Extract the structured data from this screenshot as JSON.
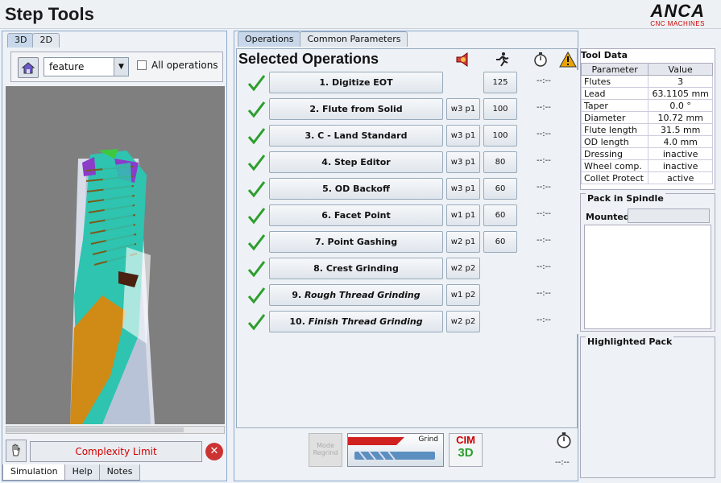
{
  "app": {
    "title": "Step Tools",
    "logo_text": "ANCA",
    "logo_sub": "CNC MACHINES"
  },
  "left": {
    "tabs": [
      "3D",
      "2D"
    ],
    "feature_select": "feature",
    "all_operations_label": "All operations",
    "complexity_label": "Complexity Limit",
    "bottom_tabs": [
      "Simulation",
      "Help",
      "Notes"
    ]
  },
  "center": {
    "tabs": [
      "Operations",
      "Common Parameters"
    ],
    "section_title": "Selected Operations",
    "operations": [
      {
        "label": "1. Digitize EOT",
        "wp": "",
        "num": "125",
        "time": "--:--"
      },
      {
        "label": "2. Flute from Solid",
        "wp": "w3 p1",
        "num": "100",
        "time": "--:--"
      },
      {
        "label": "3. C - Land Standard",
        "wp": "w3 p1",
        "num": "100",
        "time": "--:--"
      },
      {
        "label": "4. Step Editor",
        "wp": "w3 p1",
        "num": "80",
        "time": "--:--"
      },
      {
        "label": "5. OD Backoff",
        "wp": "w3 p1",
        "num": "60",
        "time": "--:--"
      },
      {
        "label": "6. Facet Point",
        "wp": "w1 p1",
        "num": "60",
        "time": "--:--"
      },
      {
        "label": "7. Point Gashing",
        "wp": "w2 p1",
        "num": "60",
        "time": "--:--"
      },
      {
        "label": "8. Crest Grinding",
        "wp": "w2 p2",
        "num": "",
        "time": "--:--"
      },
      {
        "label": "9. Rough Thread Grinding",
        "wp": "w1 p2",
        "num": "",
        "time": "--:--"
      },
      {
        "label": "10. Finish Thread Grinding",
        "wp": "w2 p2",
        "num": "",
        "time": "--:--"
      }
    ],
    "op9_num": "9.",
    "op9_text": "Rough Thread Grinding",
    "op10_num": "10.",
    "op10_text": "Finish Thread Grinding",
    "mode_btn": "Mode Regrind",
    "grind_label": "Grind",
    "cim_label": "CIM",
    "cim_sub": "3D",
    "total_time": "--:--"
  },
  "tool_data": {
    "title": "Tool Data",
    "col_param": "Parameter",
    "col_value": "Value",
    "rows": [
      {
        "p": "Flutes",
        "v": "3"
      },
      {
        "p": "Lead",
        "v": "63.1105 mm"
      },
      {
        "p": "Taper",
        "v": "0.0 °"
      },
      {
        "p": "Diameter",
        "v": "10.72 mm"
      },
      {
        "p": "Flute length",
        "v": "31.5 mm"
      },
      {
        "p": "OD length",
        "v": "4.0 mm"
      },
      {
        "p": "Dressing",
        "v": "inactive"
      },
      {
        "p": "Wheel comp.",
        "v": "inactive"
      },
      {
        "p": "Collet Protect",
        "v": "active"
      }
    ]
  },
  "pack": {
    "title": "Pack in Spindle",
    "mounted_label": "Mounted"
  },
  "highlighted": {
    "title": "Highlighted Pack"
  },
  "colors": {
    "accent": "#8aa8cc",
    "check": "#2e9e2e",
    "warn": "#e8a400",
    "error": "#cc3333"
  }
}
